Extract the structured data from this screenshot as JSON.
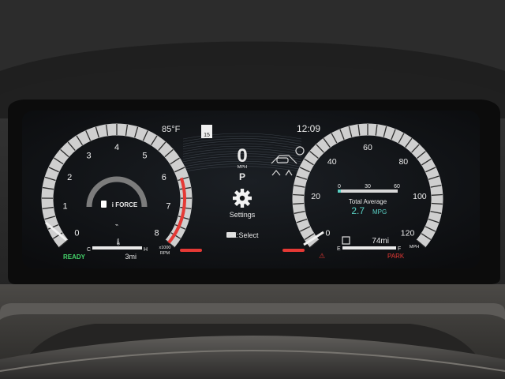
{
  "cluster": {
    "temperature": "85°F",
    "seatbelt_sign": "15",
    "time": "12:09",
    "speed": "0",
    "speed_unit": "MPH",
    "gear": "P",
    "settings_label": "Settings",
    "ok_select": "OK:Select",
    "ready": "READY",
    "odometer_trip": "3mi",
    "range": "74mi",
    "park": "PARK",
    "tach": {
      "labels": [
        "0",
        "1",
        "2",
        "3",
        "4",
        "5",
        "6",
        "7",
        "8"
      ],
      "unit_line1": "x1000",
      "unit_line2": "RPM"
    },
    "speedo": {
      "labels": [
        "0",
        "20",
        "40",
        "60",
        "80",
        "100",
        "120"
      ],
      "unit": "MPH"
    },
    "brand_text": "i FORCE",
    "temp_gauge": {
      "low": "C",
      "high": "H"
    },
    "fuel_gauge": {
      "low": "E",
      "high": "F"
    },
    "mpg": {
      "scale": [
        "0",
        "30",
        "60"
      ],
      "label": "Total Average",
      "value": "2.7",
      "unit": "MPG"
    },
    "colors": {
      "accent_red": "#e53935",
      "ready_green": "#44d36a",
      "mpg_teal": "#59d0c4"
    }
  }
}
